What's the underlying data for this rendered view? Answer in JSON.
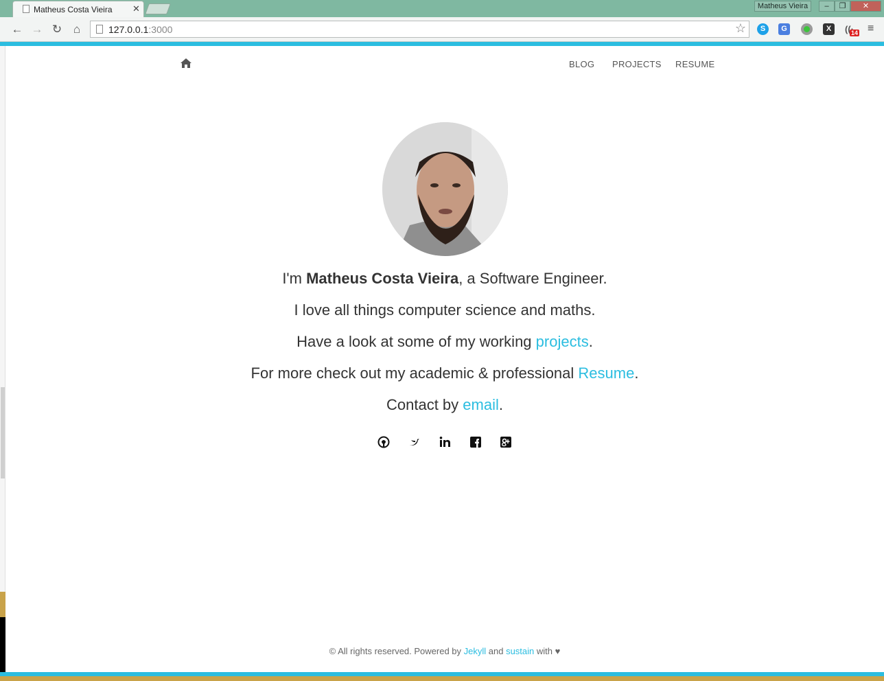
{
  "browser": {
    "tab_title": "Matheus Costa Vieira",
    "url_host": "127.0.0.1",
    "url_port": ":3000",
    "profile_name": "Matheus Vieira",
    "notification_badge": "14"
  },
  "page": {
    "nav": [
      "BLOG",
      "PROJECTS",
      "RESUME"
    ],
    "intro_prefix": "I'm ",
    "name": "Matheus Costa Vieira",
    "intro_suffix": ", a Software Engineer.",
    "line2": "I love all things computer science and maths.",
    "line3_prefix": "Have a look at some of my working ",
    "line3_link": "projects",
    "line3_suffix": ".",
    "line4_prefix": "For more check out my academic & professional ",
    "line4_link": "Resume",
    "line4_suffix": ".",
    "line5_prefix": "Contact by ",
    "line5_link": "email",
    "line5_suffix": ".",
    "social_icons": [
      "github-icon",
      "twitter-icon",
      "linkedin-icon",
      "facebook-icon",
      "google-plus-icon"
    ],
    "footer_prefix": "© All rights reserved. Powered by ",
    "footer_link1": "Jekyll",
    "footer_mid": " and ",
    "footer_link2": "sustain",
    "footer_suffix": " with ♥"
  },
  "colors": {
    "accent": "#2bbde0",
    "text": "#333333",
    "frame": "#7fb8a1"
  }
}
